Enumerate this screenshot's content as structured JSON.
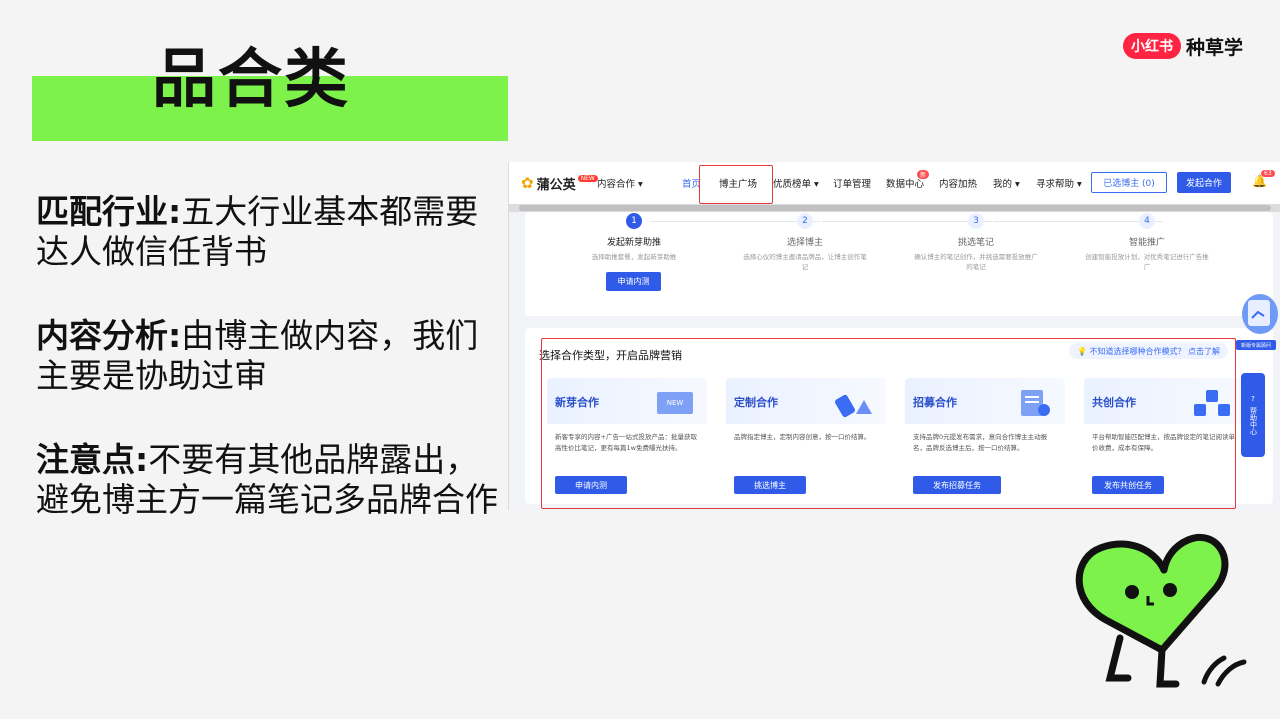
{
  "slide": {
    "title": "品合类",
    "points": [
      {
        "label": "匹配行业:",
        "text": "五大行业基本都需要达人做信任背书"
      },
      {
        "label": "内容分析:",
        "text": "由博主做内容，我们主要是协助过审"
      },
      {
        "label": "注意点:",
        "text": "不要有其他品牌露出，避免博主方一篇笔记多品牌合作"
      }
    ]
  },
  "logo": {
    "badge": "小红书",
    "text": "种草学"
  },
  "screenshot": {
    "brand": {
      "name": "蒲公英",
      "tag": "NEW"
    },
    "nav": [
      "内容合作 ▾",
      "首页",
      "博主广场",
      "优质榜单 ▾",
      "订单管理",
      "数据中心",
      "内容加热",
      "我的 ▾",
      "寻求帮助 ▾"
    ],
    "data_center_badge": "新",
    "selected_btn": "已选博主 (0)",
    "start_btn": "发起合作",
    "bell_count": "63",
    "steps": [
      {
        "num": "1",
        "title": "发起新芽助推",
        "desc": "选择助推套餐，发起新芽助推"
      },
      {
        "num": "2",
        "title": "选择博主",
        "desc": "选择心仪的博主邀请品牌品，让博主创作笔记"
      },
      {
        "num": "3",
        "title": "挑选笔记",
        "desc": "确认博主的笔记创作，并挑选需要投放推广的笔记"
      },
      {
        "num": "4",
        "title": "智能推广",
        "desc": "创建智能投放计划，对优秀笔记进行广告推广"
      }
    ],
    "apply_test": "申请内测",
    "coop_title": "选择合作类型，开启品牌营销",
    "coop_help": "不知道选择哪种合作模式？ 点击了解",
    "coop_items": [
      {
        "name": "新芽合作",
        "art": "NEW",
        "desc": "新客专享的内容+广告一站式投放产品：批量获取高性价比笔记，更有每篇1w免费曝光扶持。",
        "btn": "申请内测"
      },
      {
        "name": "定制合作",
        "desc": "品牌指定博主，定制内容创意，按一口价结算。",
        "btn": "挑选博主"
      },
      {
        "name": "招募合作",
        "desc": "支持品牌0元提发布需求，意向合作博主主动报名，品牌反选博主后，按一口价结算。",
        "btn": "发布招募任务"
      },
      {
        "name": "共创合作",
        "desc": "平台帮助智能匹配博主，按品牌设定的笔记阅读单价收费，成本有保障。",
        "btn": "发布共创任务"
      }
    ],
    "float_help": "帮助中心",
    "float_label": "新版专属顾问"
  },
  "colors": {
    "accent_green": "#7cf24a",
    "primary_blue": "#2f5be8",
    "highlight_red": "#e83a3a",
    "brand_red": "#ff2442"
  }
}
